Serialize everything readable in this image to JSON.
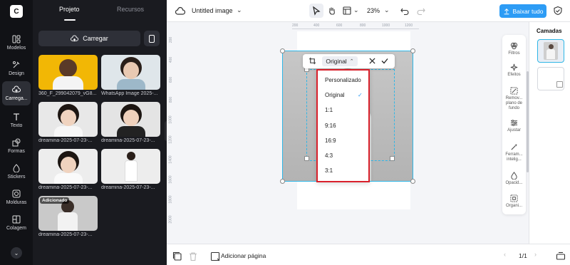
{
  "rail": {
    "items": [
      {
        "label": "Modelos",
        "icon": "grid-icon"
      },
      {
        "label": "Design",
        "icon": "palette-icon"
      },
      {
        "label": "Carrega...",
        "icon": "cloud-upload-icon"
      },
      {
        "label": "Texto",
        "icon": "text-icon"
      },
      {
        "label": "Formas",
        "icon": "shapes-icon"
      },
      {
        "label": "Stickers",
        "icon": "sticker-icon"
      },
      {
        "label": "Molduras",
        "icon": "frame-icon"
      },
      {
        "label": "Colagem",
        "icon": "collage-icon"
      }
    ]
  },
  "panel": {
    "tabs": [
      {
        "label": "Projeto"
      },
      {
        "label": "Recursos"
      }
    ],
    "upload_label": "Carregar",
    "thumbs": [
      {
        "label": "360_F_299042079_vG8..."
      },
      {
        "label": "WhatsApp Image 2025-..."
      },
      {
        "label": "dreamina-2025-07-23-..."
      },
      {
        "label": "dreamina-2025-07-23-..."
      },
      {
        "label": "dreamina-2025-07-23-..."
      },
      {
        "label": "dreamina-2025-07-23-..."
      },
      {
        "label": "dreamina-2025-07-23-...",
        "badge": "Adicionado"
      }
    ]
  },
  "topbar": {
    "title": "Untitled image",
    "zoom": "23%",
    "download_label": "Baixar tudo"
  },
  "canvas": {
    "ruler_h": [
      "200",
      "400",
      "600",
      "800",
      "1000",
      "1200"
    ],
    "ruler_v": [
      "200",
      "400",
      "600",
      "800",
      "1000",
      "1200",
      "1400",
      "1600",
      "1800",
      "2000"
    ],
    "crop_ratio": "Original",
    "dropdown": {
      "items": [
        {
          "label": "Personalizado"
        },
        {
          "label": "Original",
          "selected": "✓"
        },
        {
          "label": "1:1"
        },
        {
          "label": "9:16"
        },
        {
          "label": "16:9"
        },
        {
          "label": "4:3"
        },
        {
          "label": "3:1"
        }
      ]
    }
  },
  "tools": [
    {
      "label": "Filtros"
    },
    {
      "label": "Efeitos"
    },
    {
      "label": "Remov... plano de fundo"
    },
    {
      "label": "Ajustar"
    },
    {
      "label": "Ferram... intelig..."
    },
    {
      "label": "Opacid..."
    },
    {
      "label": "Organi..."
    }
  ],
  "layers": {
    "title": "Camadas"
  },
  "bottombar": {
    "add_page": "Adicionar página",
    "pager": "1/1"
  },
  "colors": {
    "accent": "#2d9cf5",
    "selection": "#2fb6e6",
    "highlight": "#d9202b"
  }
}
